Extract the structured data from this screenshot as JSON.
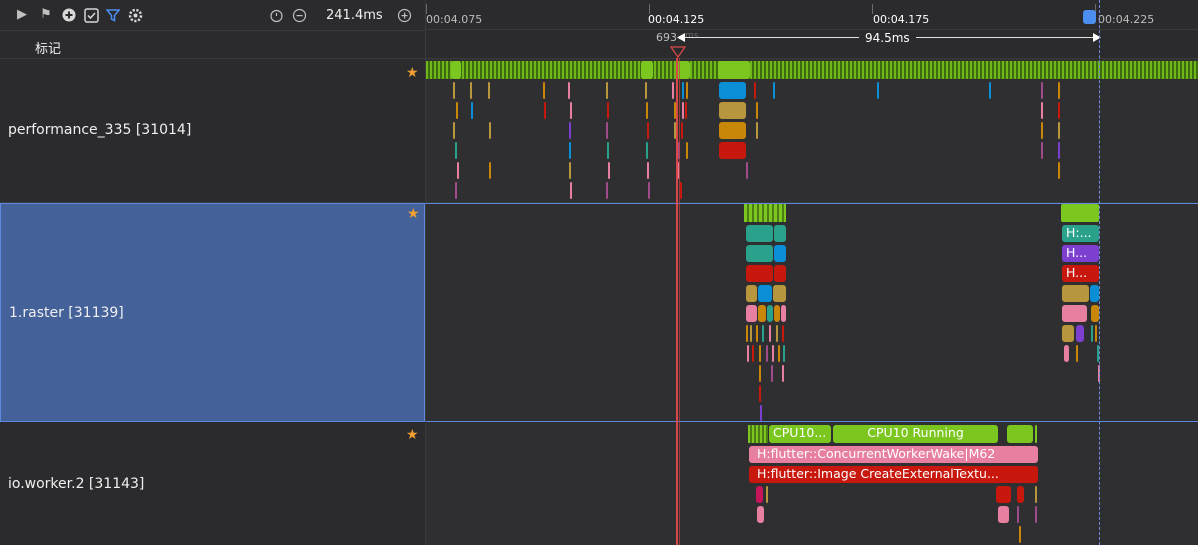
{
  "toolbar": {
    "icons": [
      "play-icon",
      "flag-icon",
      "add-circle-icon",
      "checklist-icon",
      "filter-icon",
      "gear-icon",
      "timer-icon",
      "zoom-out-icon",
      "zoom-in-icon"
    ],
    "zoom_value": "241.4ms"
  },
  "marks_label": "标记",
  "ruler": {
    "ticks": [
      "00:04.075",
      "00:04.125",
      "00:04.175",
      "00:04.225"
    ],
    "cursor_label": "693",
    "cursor_label_tail": "ms",
    "range": "94.5ms"
  },
  "lanes": [
    {
      "name": "performance_335 [31014]"
    },
    {
      "name": "1.raster [31139]"
    },
    {
      "name": "io.worker.2 [31143]"
    }
  ],
  "raster_slices": {
    "h1": "H:...",
    "h2": "H...",
    "h3": "H..."
  },
  "io_slices": {
    "cpu_short": "CPU10...",
    "cpu_running": "CPU10 Running",
    "wake": "H:flutter::ConcurrentWorkerWake|M62",
    "image": "H:flutter::Image CreateExternalTextu..."
  },
  "colors": {
    "accent": "#7cc71f",
    "selected_lane": "#44619a",
    "cursor": "#d94848"
  }
}
